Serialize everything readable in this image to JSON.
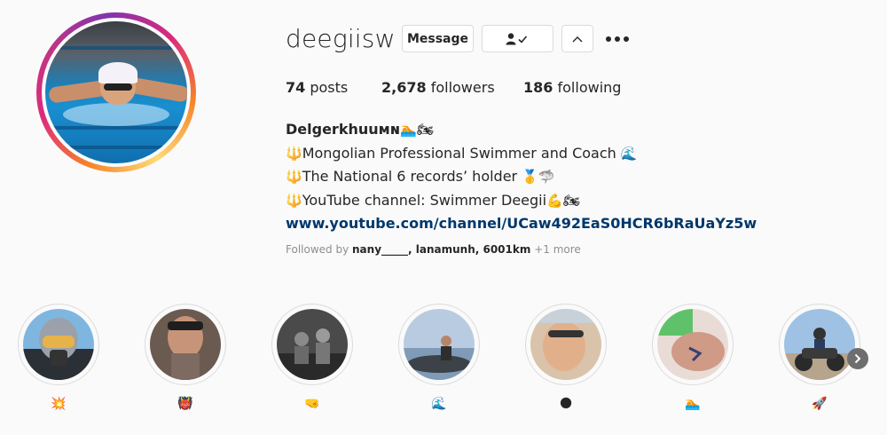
{
  "profile": {
    "username": "deegiisw",
    "buttons": {
      "message": "Message",
      "following_icon": "person-check-icon",
      "chevron_icon": "chevron-up-icon",
      "more_icon": "more-options-icon"
    },
    "stats": [
      {
        "count": "74",
        "label": "posts"
      },
      {
        "count": "2,678",
        "label": "followers"
      },
      {
        "count": "186",
        "label": "following"
      }
    ],
    "bio": {
      "name": "Delgerkhuuᴍɴ",
      "name_emoji": "🏊🏍",
      "lines": [
        {
          "prefix": "🔱",
          "text": "Mongolian Professional Swimmer and Coach",
          "suffix": "🌊"
        },
        {
          "prefix": "🔱",
          "text": "The National 6 records’ holder",
          "suffix": "🥇🦈"
        },
        {
          "prefix": "🔱",
          "text": "YouTube channel: Swimmer Deegii",
          "suffix": "💪🏍"
        }
      ],
      "link": "www.youtube.com/channel/UCaw492EaS0HCR6bRaUaYz5w"
    },
    "followed_by": {
      "prefix": "Followed by",
      "names": "nany_____, lanamunh, 6001km",
      "more": "+1 more"
    }
  },
  "highlights": [
    {
      "label": "💥",
      "theme": "helmet"
    },
    {
      "label": "👹",
      "theme": "tattoo"
    },
    {
      "label": "🤜",
      "theme": "group"
    },
    {
      "label": "🌊",
      "theme": "sea"
    },
    {
      "label": "🌑",
      "theme": "selfie"
    },
    {
      "label": "🏊",
      "theme": "hand"
    },
    {
      "label": "🚀",
      "theme": "motorcycle"
    }
  ],
  "colors": {
    "link": "#00376b",
    "text": "#262626",
    "muted": "#8e8e8e",
    "border": "#dbdbdb"
  }
}
